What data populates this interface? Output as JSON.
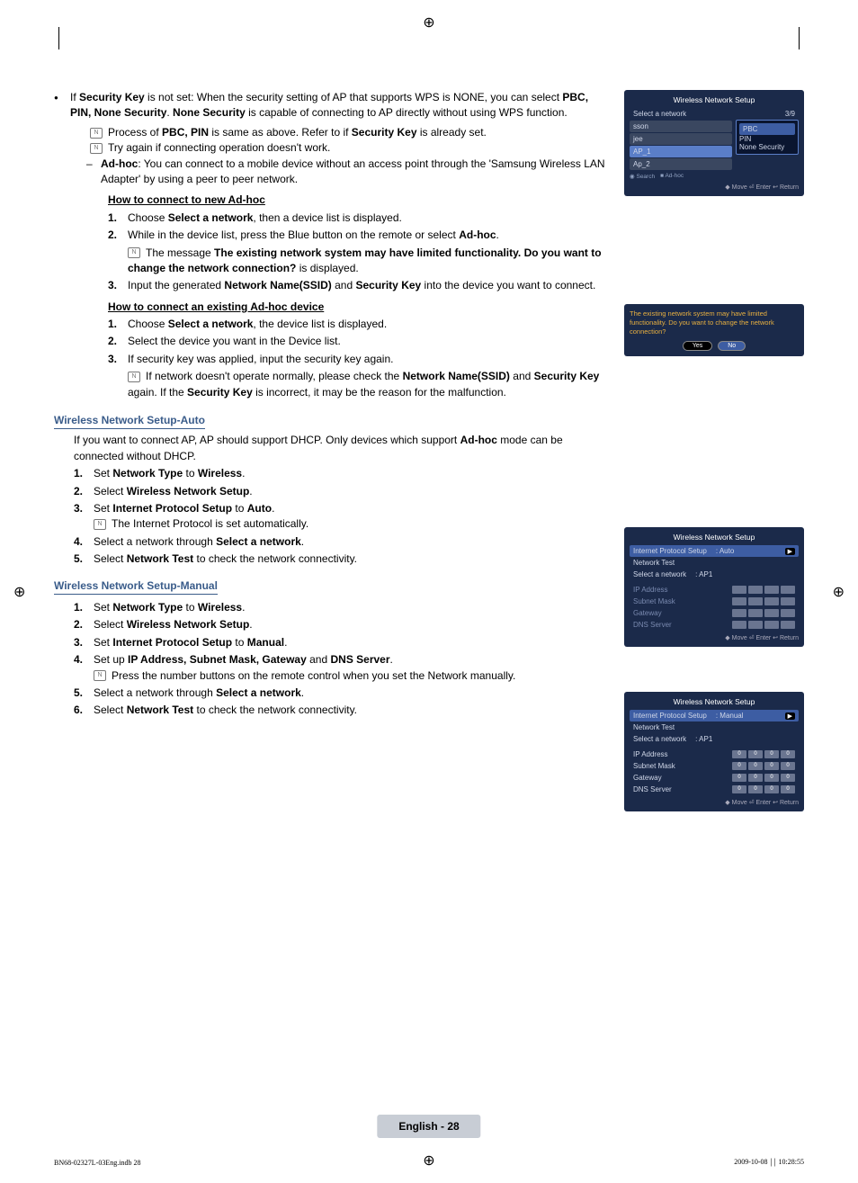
{
  "cropmark": "⊕",
  "intro": {
    "line1a": "If ",
    "line1b": "Security Key",
    "line1c": " is not set: When the security setting of AP that supports WPS is NONE, you can select ",
    "line1d": "PBC, PIN, None Security",
    "line1e": ". ",
    "line1f": "None Security",
    "line1g": " is capable of connecting to AP directly without using WPS function.",
    "note1a": "Process of ",
    "note1b": "PBC, PIN",
    "note1c": " is same as above. Refer to if ",
    "note1d": "Security Key",
    "note1e": " is already set.",
    "note2": "Try again if connecting operation doesn't work.",
    "adhoc_label": "Ad-hoc",
    "adhoc_text": ": You can connect to a mobile device without an access point through the 'Samsung Wireless LAN Adapter' by using a peer to peer network."
  },
  "newAdhoc": {
    "heading": "How to connect to new Ad-hoc",
    "s1a": "Choose ",
    "s1b": "Select a network",
    "s1c": ", then a device list is displayed.",
    "s2a": "While in the device list, press the Blue button on the remote or select ",
    "s2b": "Ad-hoc",
    "s2c": ".",
    "note_a": "The message ",
    "note_b": "The existing network system may have limited functionality. Do you want to change the network connection?",
    "note_c": " is displayed.",
    "s3a": "Input the generated ",
    "s3b": "Network Name(SSID)",
    "s3c": " and ",
    "s3d": "Security Key",
    "s3e": " into the device you want to connect."
  },
  "existAdhoc": {
    "heading": "How to connect an existing Ad-hoc device",
    "s1a": "Choose ",
    "s1b": "Select a network",
    "s1c": ", the device list is displayed.",
    "s2": "Select the device you want in the Device list.",
    "s3": "If security key was applied, input the security key again.",
    "note_a": "If network doesn't operate normally, please check the ",
    "note_b": "Network Name(SSID)",
    "note_c": " and ",
    "note_d": "Security Key",
    "note_e": " again. If the ",
    "note_f": "Security Key",
    "note_g": " is incorrect, it may be the reason for the malfunction."
  },
  "auto": {
    "heading": "Wireless Network Setup-Auto",
    "intro_a": "If you want to connect AP, AP should support DHCP. Only devices which support ",
    "intro_b": "Ad-hoc",
    "intro_c": " mode can be connected without DHCP.",
    "s1a": "Set ",
    "s1b": "Network Type",
    "s1c": " to ",
    "s1d": "Wireless",
    "s1e": ".",
    "s2a": "Select ",
    "s2b": "Wireless Network Setup",
    "s2c": ".",
    "s3a": "Set ",
    "s3b": "Internet Protocol Setup",
    "s3c": " to ",
    "s3d": "Auto",
    "s3e": ".",
    "s3note": "The Internet Protocol is set automatically.",
    "s4a": "Select a network through ",
    "s4b": "Select a network",
    "s4c": ".",
    "s5a": "Select ",
    "s5b": "Network Test",
    "s5c": " to check the network connectivity."
  },
  "manual": {
    "heading": "Wireless Network Setup-Manual",
    "s1a": "Set ",
    "s1b": "Network Type",
    "s1c": " to ",
    "s1d": "Wireless",
    "s1e": ".",
    "s2a": "Select ",
    "s2b": "Wireless Network Setup",
    "s2c": ".",
    "s3a": "Set ",
    "s3b": "Internet Protocol Setup",
    "s3c": " to ",
    "s3d": "Manual",
    "s3e": ".",
    "s4a": "Set up ",
    "s4b": "IP Address, Subnet Mask, Gateway",
    "s4c": " and ",
    "s4d": "DNS Server",
    "s4e": ".",
    "s4note": "Press the number buttons on the remote control when you set the Network manually.",
    "s5a": "Select a network through ",
    "s5b": "Select a network",
    "s5c": ".",
    "s6a": "Select ",
    "s6b": "Network Test",
    "s6c": " to check the network connectivity."
  },
  "osd1": {
    "title": "Wireless Network Setup",
    "select": "Select a network",
    "count": "3/9",
    "search": "Search",
    "adhoc": "Ad-hoc",
    "list": [
      "sson",
      "jee",
      "AP_1",
      "Ap_2"
    ],
    "popup": [
      "PBC",
      "PIN",
      "None Security"
    ],
    "footer": "◆ Move   ⏎ Enter   ↩ Return"
  },
  "osd2": {
    "msg": "The existing network system may have limited functionality. Do you want to change the network connection?",
    "yes": "Yes",
    "no": "No"
  },
  "osd3": {
    "title": "Wireless Network Setup",
    "r1l": "Internet Protocol Setup",
    "r1v": ": Auto",
    "r2": "Network Test",
    "r3l": "Select a network",
    "r3v": ": AP1",
    "ip": "IP Address",
    "sm": "Subnet Mask",
    "gw": "Gateway",
    "dns": "DNS Server",
    "footer": "◆ Move   ⏎ Enter   ↩ Return"
  },
  "osd4": {
    "title": "Wireless Network Setup",
    "r1l": "Internet Protocol Setup",
    "r1v": ": Manual",
    "r2": "Network Test",
    "r3l": "Select a network",
    "r3v": ": AP1",
    "ip": "IP Address",
    "sm": "Subnet Mask",
    "gw": "Gateway",
    "dns": "DNS Server",
    "ip_vals": [
      "0",
      "0",
      "0",
      "0"
    ],
    "sm_vals": [
      "0",
      "0",
      "0",
      "0"
    ],
    "gw_vals": [
      "0",
      "0",
      "0",
      "0"
    ],
    "dns_vals": [
      "0",
      "0",
      "0",
      "0"
    ],
    "footer": "◆ Move   ⏎ Enter   ↩ Return"
  },
  "footer": {
    "page": "English - 28",
    "left": "BN68-02327L-03Eng.indb   28",
    "right": "2009-10-08   ￨￨ 10:28:55"
  }
}
